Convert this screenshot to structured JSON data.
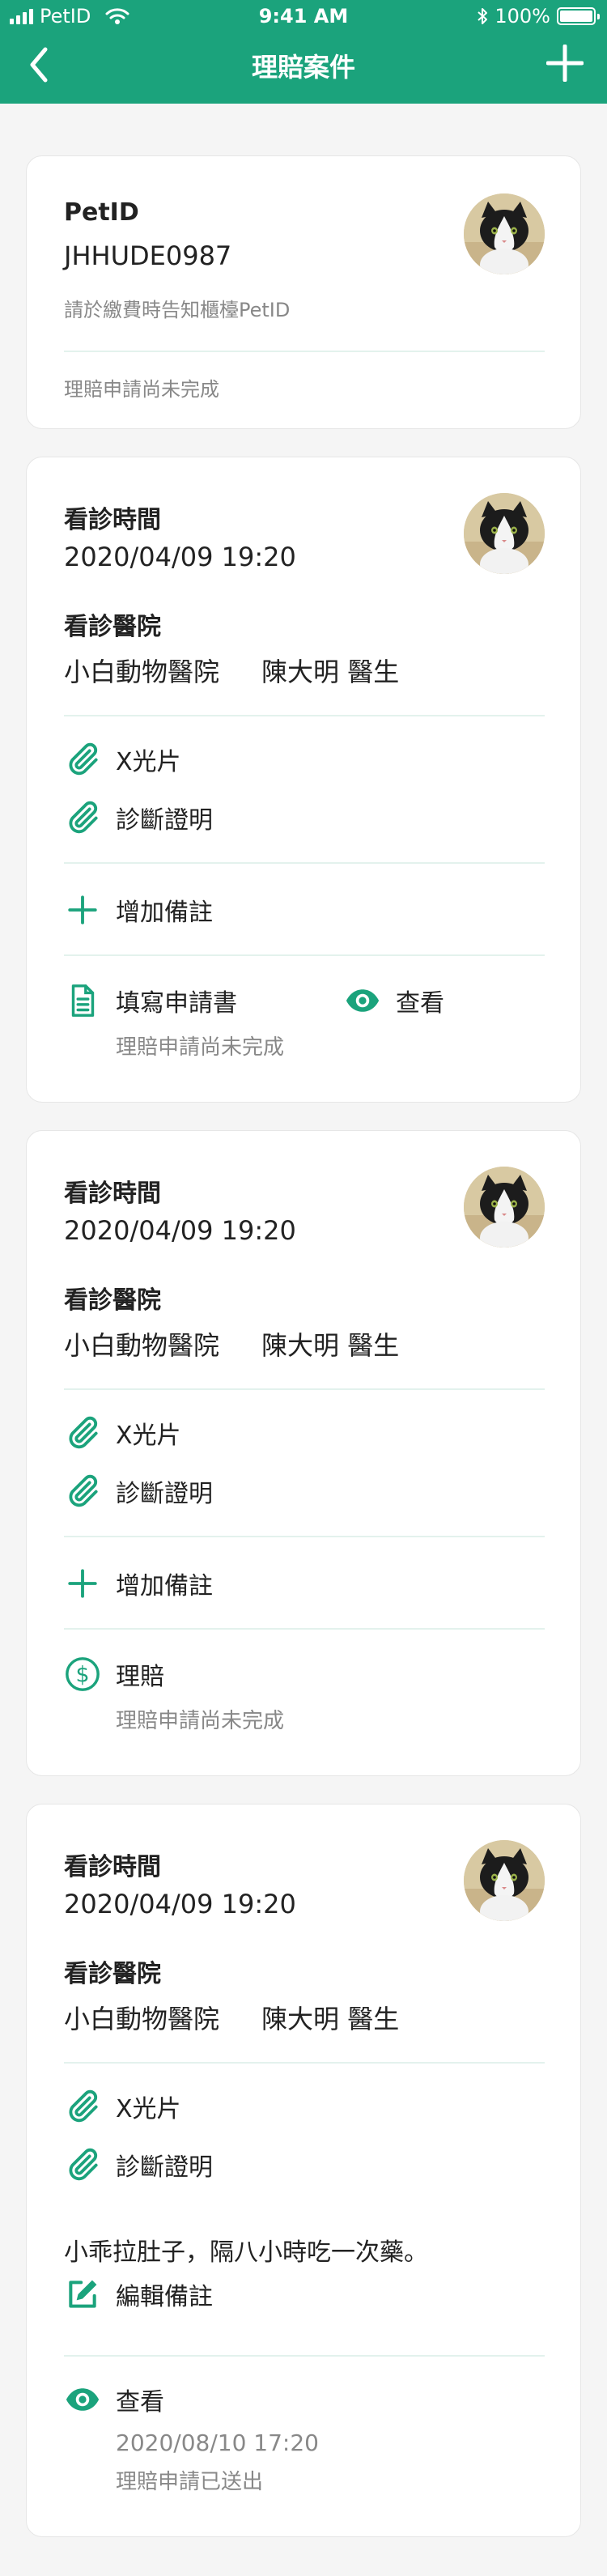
{
  "status_bar": {
    "carrier": "PetID",
    "time": "9:41 AM",
    "battery": "100%",
    "battery_level": 1.0
  },
  "nav": {
    "title": "理賠案件"
  },
  "petid_card": {
    "label": "PetID",
    "id": "JHHUDE0987",
    "hint": "請於繳費時告知櫃檯PetID",
    "status": "理賠申請尚未完成"
  },
  "common": {
    "visit_time_label": "看診時間",
    "hospital_label": "看診醫院",
    "attachment_xray": "X光片",
    "attachment_diagnosis": "診斷證明",
    "add_note": "增加備註",
    "edit_note": "編輯備註",
    "view": "查看",
    "fill_form": "填寫申請書",
    "claim": "理賠"
  },
  "cases": [
    {
      "visit_time": "2020/04/09 19:20",
      "hospital": "小白動物醫院",
      "doctor": "陳大明 醫生",
      "status": "理賠申請尚未完成"
    },
    {
      "visit_time": "2020/04/09 19:20",
      "hospital": "小白動物醫院",
      "doctor": "陳大明 醫生",
      "status": "理賠申請尚未完成"
    },
    {
      "visit_time": "2020/04/09 19:20",
      "hospital": "小白動物醫院",
      "doctor": "陳大明 醫生",
      "note": "小乖拉肚子，隔八小時吃一次藥。",
      "submitted_time": "2020/08/10 17:20",
      "status": "理賠申請已送出"
    }
  ],
  "colors": {
    "brand": "#1ba37c",
    "divider": "#e3f2ed",
    "muted": "#888888"
  },
  "icons": [
    "back-icon",
    "add-icon",
    "paperclip-icon",
    "plus-icon",
    "document-icon",
    "eye-icon",
    "dollar-icon",
    "edit-icon",
    "cat-avatar"
  ]
}
